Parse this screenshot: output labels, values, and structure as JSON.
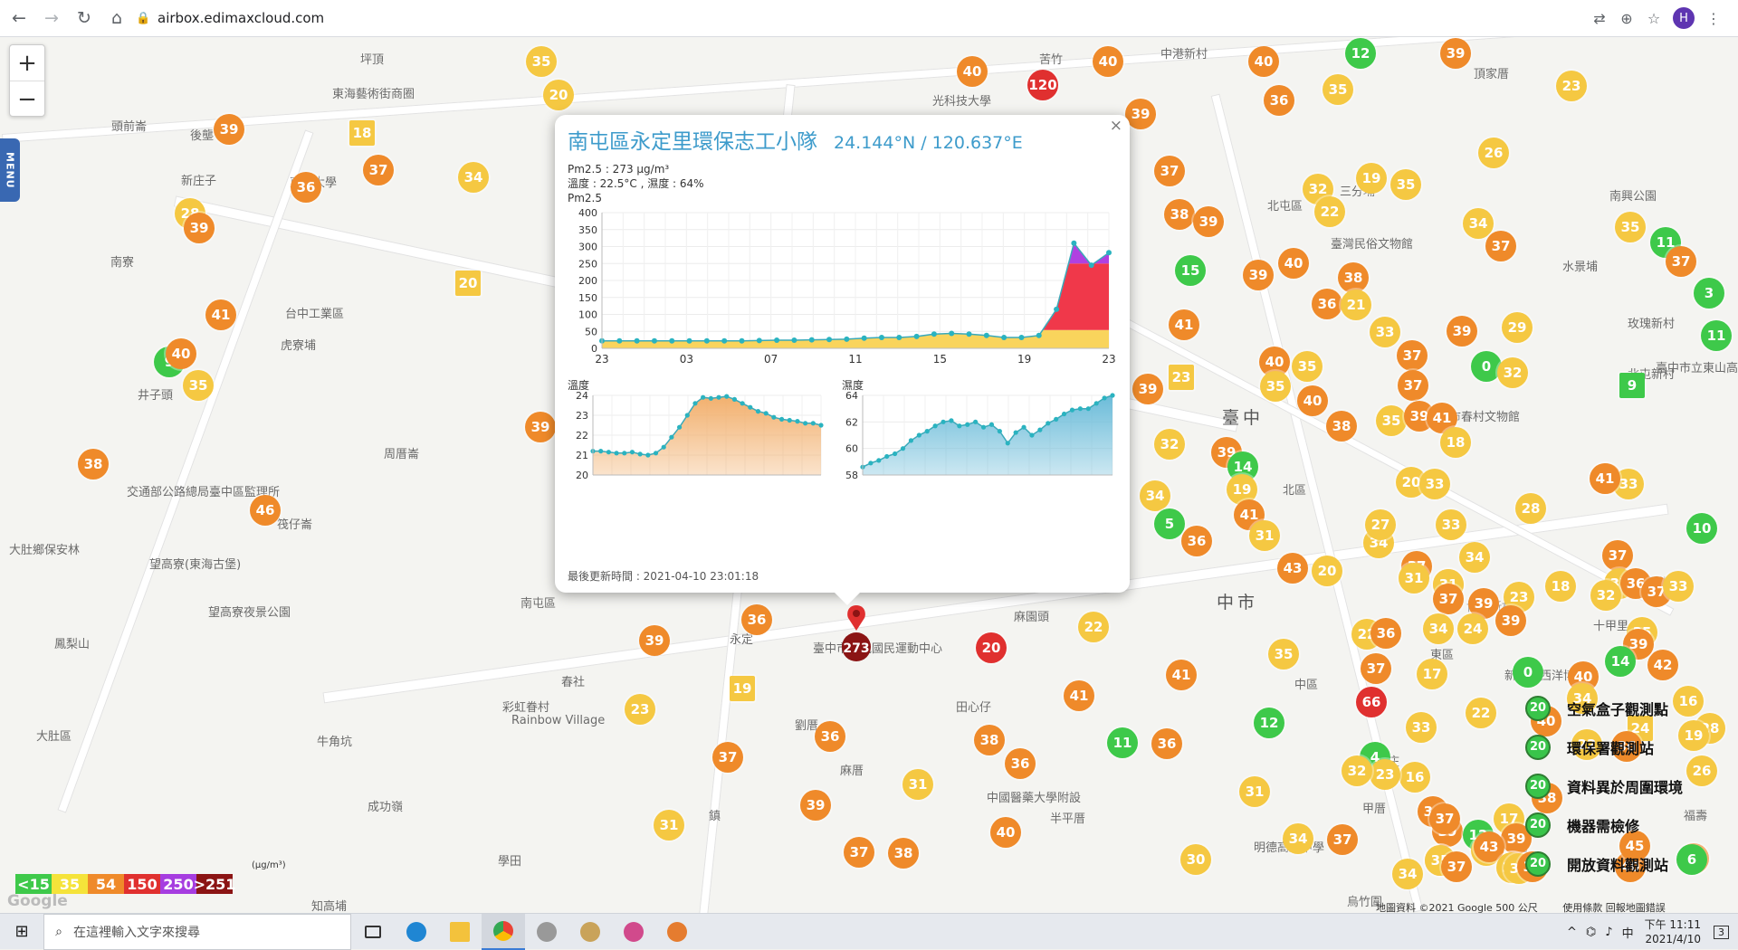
{
  "browser": {
    "url": "airbox.edimaxcloud.com",
    "profile_initial": "H"
  },
  "map": {
    "zoom_in": "+",
    "zoom_out": "−",
    "menu_label": "MENU",
    "labels": [
      {
        "text": "坪頂",
        "big": false
      },
      {
        "text": "東海藝術街商圈",
        "big": false
      },
      {
        "text": "頭前崙",
        "big": false
      },
      {
        "text": "後壟",
        "big": false
      },
      {
        "text": "新庄子",
        "big": false
      },
      {
        "text": "東海大學",
        "big": false
      },
      {
        "text": "光科技大學",
        "big": false
      },
      {
        "text": "苦竹",
        "big": false
      },
      {
        "text": "中港新村",
        "big": false
      },
      {
        "text": "頂家厝",
        "big": false
      },
      {
        "text": "南寮",
        "big": false
      },
      {
        "text": "台中工業區",
        "big": false
      },
      {
        "text": "虎寮埔",
        "big": false
      },
      {
        "text": "井子頭",
        "big": false
      },
      {
        "text": "周厝崙",
        "big": false
      },
      {
        "text": "三分埔",
        "big": false
      },
      {
        "text": "北屯區",
        "big": false
      },
      {
        "text": "臺灣民俗文物館",
        "big": false
      },
      {
        "text": "南興公園",
        "big": false
      },
      {
        "text": "水景埔",
        "big": false
      },
      {
        "text": "玫瑰新村",
        "big": false
      },
      {
        "text": "北屯新村",
        "big": false
      },
      {
        "text": "臺中",
        "big": true
      },
      {
        "text": "中市",
        "big": true
      },
      {
        "text": "東區",
        "big": false
      },
      {
        "text": "北區",
        "big": false
      },
      {
        "text": "南屯區",
        "big": false
      },
      {
        "text": "永定",
        "big": false
      },
      {
        "text": "臺中市南屯國民運動中心",
        "big": false
      },
      {
        "text": "春社",
        "big": false
      },
      {
        "text": "鳳梨山",
        "big": false
      },
      {
        "text": "大肚區",
        "big": false
      },
      {
        "text": "成功嶺",
        "big": false
      },
      {
        "text": "學田",
        "big": false
      },
      {
        "text": "知高埔",
        "big": false
      },
      {
        "text": "麻厝",
        "big": false
      },
      {
        "text": "麻園頭",
        "big": false
      },
      {
        "text": "劉厝",
        "big": false
      },
      {
        "text": "田心仔",
        "big": false
      },
      {
        "text": "中國醫藥大學附設",
        "big": false
      },
      {
        "text": "明德高級中學",
        "big": false
      },
      {
        "text": "雅才",
        "big": false
      },
      {
        "text": "大肚鄉保安林",
        "big": false
      },
      {
        "text": "交通部公路總局臺中區監理所",
        "big": false
      },
      {
        "text": "望高寮(東海古堡)",
        "big": false
      },
      {
        "text": "望高寮夜景公園",
        "big": false
      },
      {
        "text": "牛角坑",
        "big": false
      },
      {
        "text": "筏仔崙",
        "big": false
      },
      {
        "text": "彩虹眷村",
        "big": false
      },
      {
        "text": "Rainbow Village",
        "big": false
      },
      {
        "text": "鎮",
        "big": false
      },
      {
        "text": "溪洲",
        "big": false
      },
      {
        "text": "十甲里",
        "big": false
      },
      {
        "text": "博愛新村",
        "big": false
      },
      {
        "text": "新天地西洋博物館",
        "big": false
      },
      {
        "text": "中區",
        "big": false
      },
      {
        "text": "台中市春村文物館",
        "big": false
      },
      {
        "text": "後庄",
        "big": false
      },
      {
        "text": "甲厝",
        "big": false
      },
      {
        "text": "半平厝",
        "big": false
      },
      {
        "text": "烏竹圍",
        "big": false
      },
      {
        "text": "福壽",
        "big": false
      },
      {
        "text": "臺中市立東山高中",
        "big": false
      }
    ],
    "markers": [
      {
        "v": "35",
        "c": "#f5c842"
      },
      {
        "v": "20",
        "c": "#f5c842"
      },
      {
        "v": "39",
        "c": "#ef8a2a"
      },
      {
        "v": "18",
        "c": "#f5c842",
        "sq": true
      },
      {
        "v": "37",
        "c": "#ef8a2a"
      },
      {
        "v": "34",
        "c": "#f5c842"
      },
      {
        "v": "36",
        "c": "#ef8a2a"
      },
      {
        "v": "28",
        "c": "#f5c842"
      },
      {
        "v": "39",
        "c": "#ef8a2a"
      },
      {
        "v": "20",
        "c": "#f5c842",
        "sq": true
      },
      {
        "v": "41",
        "c": "#ef8a2a"
      },
      {
        "v": "9",
        "c": "#3ec94a"
      },
      {
        "v": "40",
        "c": "#ef8a2a"
      },
      {
        "v": "35",
        "c": "#f5c842"
      },
      {
        "v": "38",
        "c": "#ef8a2a"
      },
      {
        "v": "46",
        "c": "#ef8a2a"
      },
      {
        "v": "39",
        "c": "#ef8a2a"
      },
      {
        "v": "40",
        "c": "#ef8a2a"
      },
      {
        "v": "120",
        "c": "#e0302f"
      },
      {
        "v": "40",
        "c": "#ef8a2a"
      },
      {
        "v": "12",
        "c": "#3ec94a"
      },
      {
        "v": "39",
        "c": "#ef8a2a"
      },
      {
        "v": "40",
        "c": "#ef8a2a"
      },
      {
        "v": "36",
        "c": "#ef8a2a"
      },
      {
        "v": "35",
        "c": "#f5c842"
      },
      {
        "v": "23",
        "c": "#f5c842"
      },
      {
        "v": "39",
        "c": "#ef8a2a"
      },
      {
        "v": "37",
        "c": "#ef8a2a"
      },
      {
        "v": "26",
        "c": "#f5c842"
      },
      {
        "v": "38",
        "c": "#ef8a2a"
      },
      {
        "v": "32",
        "c": "#f5c842"
      },
      {
        "v": "19",
        "c": "#f5c842"
      },
      {
        "v": "22",
        "c": "#f5c842"
      },
      {
        "v": "35",
        "c": "#f5c842"
      },
      {
        "v": "38",
        "c": "#ef8a2a"
      },
      {
        "v": "39",
        "c": "#ef8a2a"
      },
      {
        "v": "34",
        "c": "#f5c842"
      },
      {
        "v": "37",
        "c": "#ef8a2a"
      },
      {
        "v": "35",
        "c": "#f5c842"
      },
      {
        "v": "11",
        "c": "#3ec94a"
      },
      {
        "v": "37",
        "c": "#ef8a2a"
      },
      {
        "v": "15",
        "c": "#3ec94a"
      },
      {
        "v": "39",
        "c": "#ef8a2a"
      },
      {
        "v": "40",
        "c": "#ef8a2a"
      },
      {
        "v": "38",
        "c": "#ef8a2a"
      },
      {
        "v": "36",
        "c": "#ef8a2a"
      },
      {
        "v": "21",
        "c": "#f5c842"
      },
      {
        "v": "3",
        "c": "#3ec94a"
      },
      {
        "v": "41",
        "c": "#ef8a2a"
      },
      {
        "v": "33",
        "c": "#f5c842"
      },
      {
        "v": "39",
        "c": "#ef8a2a"
      },
      {
        "v": "29",
        "c": "#f5c842"
      },
      {
        "v": "11",
        "c": "#3ec94a"
      },
      {
        "v": "40",
        "c": "#ef8a2a"
      },
      {
        "v": "35",
        "c": "#f5c842"
      },
      {
        "v": "37",
        "c": "#ef8a2a"
      },
      {
        "v": "0",
        "c": "#3ec94a"
      },
      {
        "v": "32",
        "c": "#f5c842"
      },
      {
        "v": "23",
        "c": "#f5c842",
        "sq": true
      },
      {
        "v": "9",
        "c": "#3ec94a",
        "sq": true
      },
      {
        "v": "39",
        "c": "#ef8a2a"
      },
      {
        "v": "35",
        "c": "#f5c842"
      },
      {
        "v": "40",
        "c": "#ef8a2a"
      },
      {
        "v": "37",
        "c": "#ef8a2a"
      },
      {
        "v": "35",
        "c": "#f5c842"
      },
      {
        "v": "39",
        "c": "#ef8a2a"
      },
      {
        "v": "41",
        "c": "#ef8a2a"
      },
      {
        "v": "32",
        "c": "#f5c842"
      },
      {
        "v": "39",
        "c": "#ef8a2a"
      },
      {
        "v": "38",
        "c": "#ef8a2a"
      },
      {
        "v": "18",
        "c": "#f5c842"
      },
      {
        "v": "14",
        "c": "#3ec94a"
      },
      {
        "v": "19",
        "c": "#f5c842"
      },
      {
        "v": "34",
        "c": "#f5c842"
      },
      {
        "v": "41",
        "c": "#ef8a2a"
      },
      {
        "v": "31",
        "c": "#f5c842"
      },
      {
        "v": "20",
        "c": "#f5c842"
      },
      {
        "v": "33",
        "c": "#f5c842"
      },
      {
        "v": "5",
        "c": "#3ec94a"
      },
      {
        "v": "36",
        "c": "#ef8a2a"
      },
      {
        "v": "34",
        "c": "#f5c842"
      },
      {
        "v": "37",
        "c": "#ef8a2a"
      },
      {
        "v": "27",
        "c": "#f5c842"
      },
      {
        "v": "33",
        "c": "#f5c842"
      },
      {
        "v": "28",
        "c": "#f5c842"
      },
      {
        "v": "10",
        "c": "#3ec94a"
      },
      {
        "v": "41",
        "c": "#ef8a2a"
      },
      {
        "v": "33",
        "c": "#f5c842"
      },
      {
        "v": "43",
        "c": "#ef8a2a"
      },
      {
        "v": "20",
        "c": "#f5c842"
      },
      {
        "v": "31",
        "c": "#f5c842"
      },
      {
        "v": "39",
        "c": "#ef8a2a"
      },
      {
        "v": "34",
        "c": "#f5c842"
      },
      {
        "v": "37",
        "c": "#ef8a2a"
      },
      {
        "v": "35",
        "c": "#f5c842"
      },
      {
        "v": "36",
        "c": "#ef8a2a"
      },
      {
        "v": "31",
        "c": "#f5c842"
      },
      {
        "v": "37",
        "c": "#ef8a2a"
      },
      {
        "v": "41",
        "c": "#ef8a2a"
      },
      {
        "v": "32",
        "c": "#f5c842"
      },
      {
        "v": "33",
        "c": "#f5c842"
      },
      {
        "v": "35",
        "c": "#f5c842"
      },
      {
        "v": "23",
        "c": "#f5c842"
      },
      {
        "v": "37",
        "c": "#ef8a2a"
      },
      {
        "v": "39",
        "c": "#ef8a2a"
      },
      {
        "v": "18",
        "c": "#f5c842"
      },
      {
        "v": "42",
        "c": "#ef8a2a"
      },
      {
        "v": "16",
        "c": "#f5c842"
      },
      {
        "v": "24",
        "c": "#f5c842",
        "sq": true
      },
      {
        "v": "28",
        "c": "#f5c842"
      },
      {
        "v": "22",
        "c": "#f5c842"
      },
      {
        "v": "36",
        "c": "#ef8a2a"
      },
      {
        "v": "22",
        "c": "#f5c842"
      },
      {
        "v": "37",
        "c": "#ef8a2a"
      },
      {
        "v": "17",
        "c": "#f5c842"
      },
      {
        "v": "0",
        "c": "#3ec94a"
      },
      {
        "v": "34",
        "c": "#f5c842"
      },
      {
        "v": "24",
        "c": "#f5c842"
      },
      {
        "v": "39",
        "c": "#ef8a2a"
      },
      {
        "v": "39",
        "c": "#ef8a2a"
      },
      {
        "v": "40",
        "c": "#ef8a2a"
      },
      {
        "v": "19",
        "c": "#f5c842"
      },
      {
        "v": "26",
        "c": "#f5c842"
      },
      {
        "v": "40",
        "c": "#ef8a2a"
      },
      {
        "v": "34",
        "c": "#f5c842"
      },
      {
        "v": "40",
        "c": "#ef8a2a"
      },
      {
        "v": "22",
        "c": "#f5c842"
      },
      {
        "v": "33",
        "c": "#f5c842"
      },
      {
        "v": "16",
        "c": "#f5c842"
      },
      {
        "v": "4",
        "c": "#3ec94a"
      },
      {
        "v": "23",
        "c": "#f5c842"
      },
      {
        "v": "36",
        "c": "#ef8a2a"
      },
      {
        "v": "39",
        "c": "#ef8a2a"
      },
      {
        "v": "17",
        "c": "#f5c842"
      },
      {
        "v": "39",
        "c": "#ef8a2a"
      },
      {
        "v": "12",
        "c": "#3ec94a"
      },
      {
        "v": "33",
        "c": "#f5c842"
      },
      {
        "v": "37",
        "c": "#ef8a2a"
      },
      {
        "v": "34",
        "c": "#f5c842"
      },
      {
        "v": "38",
        "c": "#ef8a2a"
      },
      {
        "v": "11",
        "c": "#3ec94a"
      },
      {
        "v": "48",
        "c": "#ef8a2a"
      },
      {
        "v": "34",
        "c": "#f5c842"
      },
      {
        "v": "36",
        "c": "#ef8a2a"
      },
      {
        "v": "43",
        "c": "#ef8a2a"
      },
      {
        "v": "35",
        "c": "#f5c842"
      },
      {
        "v": "37",
        "c": "#ef8a2a"
      },
      {
        "v": "31",
        "c": "#f5c842"
      },
      {
        "v": "36",
        "c": "#ef8a2a"
      },
      {
        "v": "35",
        "c": "#f5c842"
      },
      {
        "v": "34",
        "c": "#f5c842"
      },
      {
        "v": "36",
        "c": "#ef8a2a"
      },
      {
        "v": "37",
        "c": "#ef8a2a"
      },
      {
        "v": "30",
        "c": "#f5c842"
      },
      {
        "v": "35",
        "c": "#f5c842"
      },
      {
        "v": "66",
        "c": "#e0302f"
      },
      {
        "v": "6",
        "c": "#3ec94a"
      },
      {
        "v": "38",
        "c": "#ef8a2a"
      },
      {
        "v": "45",
        "c": "#ef8a2a"
      },
      {
        "v": "39",
        "c": "#ef8a2a"
      },
      {
        "v": "19",
        "c": "#f5c842",
        "sq": true
      },
      {
        "v": "36",
        "c": "#ef8a2a"
      },
      {
        "v": "31",
        "c": "#f5c842"
      },
      {
        "v": "40",
        "c": "#ef8a2a"
      },
      {
        "v": "22",
        "c": "#f5c842"
      },
      {
        "v": "41",
        "c": "#ef8a2a"
      },
      {
        "v": "12",
        "c": "#3ec94a"
      },
      {
        "v": "32",
        "c": "#f5c842"
      },
      {
        "v": "37",
        "c": "#ef8a2a"
      },
      {
        "v": "39",
        "c": "#ef8a2a"
      },
      {
        "v": "14",
        "c": "#3ec94a"
      },
      {
        "v": "23",
        "c": "#f5c842"
      },
      {
        "v": "37",
        "c": "#ef8a2a"
      },
      {
        "v": "39",
        "c": "#ef8a2a"
      },
      {
        "v": "38",
        "c": "#ef8a2a"
      },
      {
        "v": "20",
        "c": "#e0302f"
      },
      {
        "v": "41",
        "c": "#ef8a2a"
      },
      {
        "v": "36",
        "c": "#ef8a2a"
      },
      {
        "v": "31",
        "c": "#f5c842"
      },
      {
        "v": "37",
        "c": "#ef8a2a"
      }
    ],
    "selected_marker": "273",
    "google_logo": "Google",
    "copyright": "地圖資料 ©2021 Google    500 公尺",
    "terms": "使用條款    回報地圖錯誤"
  },
  "popup": {
    "close": "×",
    "title": "南屯區永定里環保志工小隊",
    "coords": "24.144°N / 120.637°E",
    "pm_line": "Pm2.5 : 273 μg/m³",
    "temp_humidity_line": "溫度 : 22.5°C , 濕度 : 64%",
    "chart_label": "Pm2.5",
    "temp_label": "溫度",
    "humidity_label": "濕度",
    "footer": "最後更新時間 : 2021-04-10 23:01:18"
  },
  "chart_data": [
    {
      "type": "area",
      "title": "Pm2.5",
      "x_ticks": [
        "23",
        "03",
        "07",
        "11",
        "15",
        "19",
        "23"
      ],
      "ylim": [
        0,
        400
      ],
      "y_ticks": [
        0,
        50,
        100,
        150,
        200,
        250,
        300,
        350,
        400
      ],
      "values": [
        22,
        22,
        22,
        22,
        22,
        22,
        22,
        22,
        22,
        23,
        24,
        24,
        25,
        26,
        27,
        30,
        32,
        32,
        35,
        42,
        44,
        42,
        38,
        32,
        32,
        38,
        115,
        310,
        245,
        282
      ],
      "color_bands": [
        "#f9d45c",
        "#f0384a",
        "#b040e0"
      ]
    },
    {
      "type": "area",
      "title": "溫度",
      "ylim": [
        20,
        24
      ],
      "y_ticks": [
        20,
        21,
        22,
        23,
        24
      ],
      "values": [
        21.2,
        21.2,
        21.15,
        21.1,
        21.1,
        21.15,
        21.05,
        21.0,
        21.1,
        21.4,
        21.9,
        22.4,
        23.0,
        23.6,
        23.9,
        23.85,
        23.9,
        23.95,
        23.8,
        23.6,
        23.4,
        23.2,
        23.1,
        22.9,
        22.8,
        22.75,
        22.7,
        22.6,
        22.6,
        22.5
      ],
      "color": "#f2b06e"
    },
    {
      "type": "area",
      "title": "濕度",
      "ylim": [
        58,
        64
      ],
      "y_ticks": [
        58,
        60,
        62,
        64
      ],
      "values": [
        58.6,
        58.9,
        59.1,
        59.4,
        59.6,
        60.0,
        60.6,
        61.0,
        61.3,
        61.7,
        62.0,
        62.1,
        61.7,
        61.8,
        62.0,
        61.6,
        61.8,
        61.3,
        60.4,
        61.2,
        61.6,
        61.0,
        61.4,
        61.9,
        62.2,
        62.6,
        62.9,
        63.0,
        63.0,
        63.4,
        63.8,
        64.0
      ],
      "color": "#6cbcd9"
    }
  ],
  "pm_legend": {
    "unit": "(μg/m³)",
    "items": [
      {
        "label": "<15",
        "color": "#3ec94a"
      },
      {
        "label": "35",
        "color": "#f5e33a"
      },
      {
        "label": "54",
        "color": "#ef8a2a"
      },
      {
        "label": "150",
        "color": "#e0302f"
      },
      {
        "label": "250",
        "color": "#a63de0"
      },
      {
        "label": ">251",
        "color": "#8b1414"
      }
    ]
  },
  "station_legend": [
    {
      "icon": "20",
      "label": "空氣盒子觀測點"
    },
    {
      "icon": "20",
      "label": "環保署觀測站"
    },
    {
      "icon": "20",
      "label": "資料異於周圍環境"
    },
    {
      "icon": "20",
      "label": "機器需檢修"
    },
    {
      "icon": "20",
      "label": "開放資料觀測站"
    }
  ],
  "taskbar": {
    "search_placeholder": "在這裡輸入文字來搜尋",
    "tray_text": "中",
    "time": "下午 11:11",
    "date": "2021/4/10",
    "notif_count": "3"
  }
}
